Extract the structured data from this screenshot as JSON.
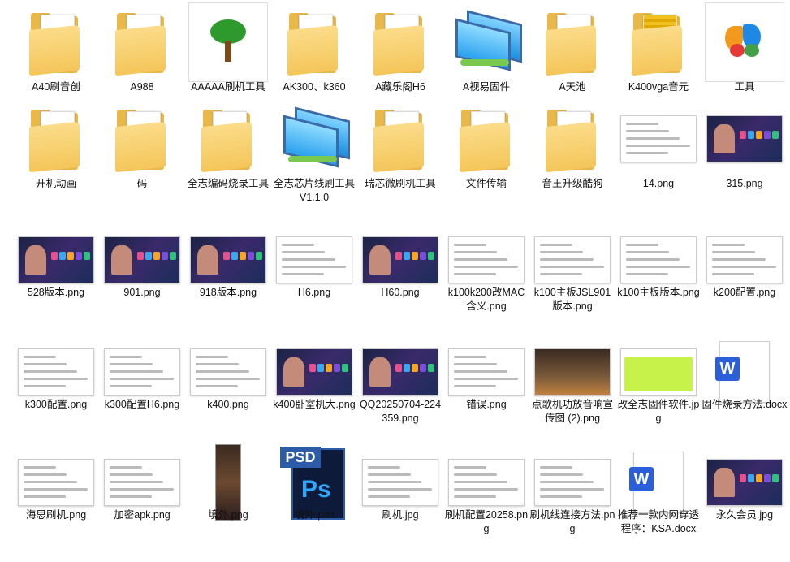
{
  "items": [
    {
      "label": "A40刷音创",
      "type": "folder"
    },
    {
      "label": "A988",
      "type": "folder"
    },
    {
      "label": "AAAAA刷机工具",
      "type": "tree"
    },
    {
      "label": "AK300、k360",
      "type": "folder"
    },
    {
      "label": "A藏乐阁H6",
      "type": "folder"
    },
    {
      "label": "A视易固件",
      "type": "monitor"
    },
    {
      "label": "A天池",
      "type": "folder"
    },
    {
      "label": "K400vga音元",
      "type": "zipfolder"
    },
    {
      "label": "工具",
      "type": "butterfly"
    },
    {
      "label": "开机动画",
      "type": "folder"
    },
    {
      "label": "码",
      "type": "folder"
    },
    {
      "label": "全志编码烧录工具",
      "type": "wordfolder"
    },
    {
      "label": "全志芯片线刷工具V1.1.0",
      "type": "monitor"
    },
    {
      "label": "瑞芯微刷机工具",
      "type": "folder"
    },
    {
      "label": "文件传输",
      "type": "folder"
    },
    {
      "label": "音王升级酷狗",
      "type": "folder"
    },
    {
      "label": "14.png",
      "type": "img-light"
    },
    {
      "label": "315.png",
      "type": "img-dark"
    },
    {
      "label": "528版本.png",
      "type": "img-dark"
    },
    {
      "label": "901.png",
      "type": "img-dark"
    },
    {
      "label": "918版本.png",
      "type": "img-dark"
    },
    {
      "label": "H6.png",
      "type": "img-light"
    },
    {
      "label": "H60.png",
      "type": "img-dark"
    },
    {
      "label": "k100k200改MAC含义.png",
      "type": "img-light"
    },
    {
      "label": "k100主板JSL901版本.png",
      "type": "img-light"
    },
    {
      "label": "k100主板版本.png",
      "type": "img-light"
    },
    {
      "label": "k200配置.png",
      "type": "img-light"
    },
    {
      "label": "k300配置.png",
      "type": "img-light"
    },
    {
      "label": "k300配置H6.png",
      "type": "img-light"
    },
    {
      "label": "k400.png",
      "type": "img-light"
    },
    {
      "label": "k400卧室机大.png",
      "type": "img-dark"
    },
    {
      "label": "QQ20250704-224359.png",
      "type": "img-dark"
    },
    {
      "label": "错误.png",
      "type": "img-light"
    },
    {
      "label": "点歌机功放音响宣传图 (2).png",
      "type": "img-photo"
    },
    {
      "label": "改全志固件软件.jpg",
      "type": "img-green"
    },
    {
      "label": "固件烧录方法.docx",
      "type": "word"
    },
    {
      "label": "海思刷机.png",
      "type": "img-light"
    },
    {
      "label": "加密apk.png",
      "type": "img-light"
    },
    {
      "label": "境外.png",
      "type": "img-tall"
    },
    {
      "label": "境外.psd",
      "type": "psd"
    },
    {
      "label": "刷机.jpg",
      "type": "img-light"
    },
    {
      "label": "刷机配置20258.png",
      "type": "img-light"
    },
    {
      "label": "刷机线连接方法.png",
      "type": "img-light"
    },
    {
      "label": "推荐一款内网穿透程序：KSA.docx",
      "type": "word"
    },
    {
      "label": "永久会员.jpg",
      "type": "img-dark"
    }
  ],
  "icons": {
    "psd_text": "PSD",
    "ps_text": "Ps",
    "word_letter": "W"
  }
}
